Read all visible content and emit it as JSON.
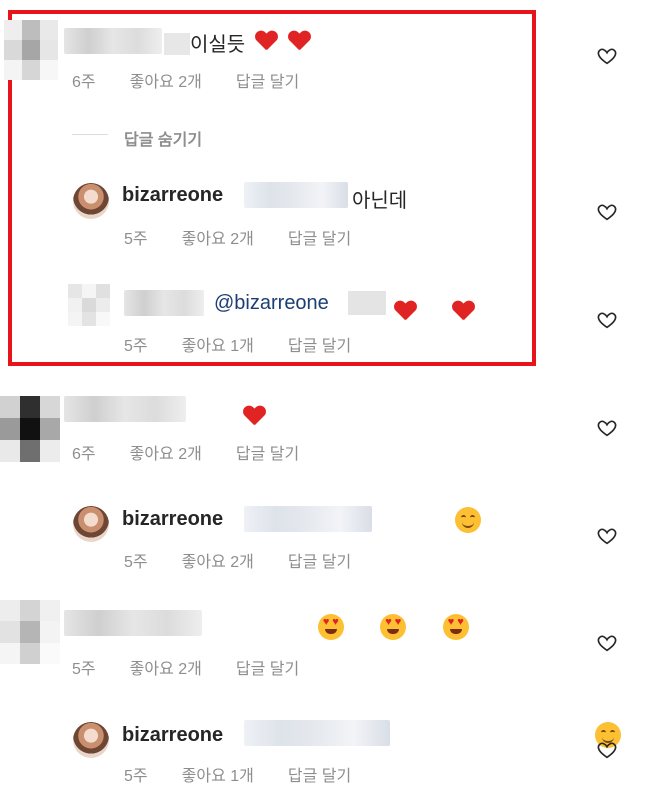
{
  "comments": [
    {
      "time": "6주",
      "likes": "좋아요 2개",
      "reply": "답글 달기",
      "text_visible": "이실듯"
    },
    {
      "hide_replies": "답글 숨기기"
    },
    {
      "username": "bizarreone",
      "text_end": "아닌데",
      "time": "5주",
      "likes": "좋아요 2개",
      "reply": "답글 달기"
    },
    {
      "mention": "@bizarreone",
      "time": "5주",
      "likes": "좋아요 1개",
      "reply": "답글 달기"
    },
    {
      "time": "6주",
      "likes": "좋아요 2개",
      "reply": "답글 달기"
    },
    {
      "username": "bizarreone",
      "time": "5주",
      "likes": "좋아요 2개",
      "reply": "답글 달기"
    },
    {
      "time": "5주",
      "likes": "좋아요 2개",
      "reply": "답글 달기"
    },
    {
      "username": "bizarreone",
      "time": "5주",
      "likes": "좋아요 1개",
      "reply": "답글 달기"
    }
  ],
  "colors": {
    "highlight": "#e8141b",
    "meta": "#8e8e8e",
    "mention": "#1c3f73",
    "heart": "#e02424"
  },
  "icons": {
    "like": "heart-outline-icon",
    "emoji_heart": "red-heart-emoji",
    "emoji_smile": "smiling-face-emoji",
    "emoji_heart_eyes": "heart-eyes-emoji"
  }
}
